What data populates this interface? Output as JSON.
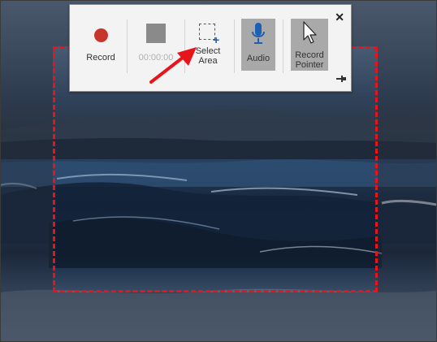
{
  "toolbar": {
    "record_label": "Record",
    "timer": "00:00:00",
    "select_area_line1": "Select",
    "select_area_line2": "Area",
    "audio_label": "Audio",
    "record_pointer_line1": "Record",
    "record_pointer_line2": "Pointer",
    "close_symbol": "✕",
    "audio_active": true,
    "record_pointer_active": true
  },
  "colors": {
    "selection_border": "#e8141b",
    "record_dot": "#c8352b",
    "annotation_arrow": "#e8141b",
    "active_button": "#a9a9a9",
    "toolbar_bg": "#f3f3f3"
  },
  "icons": {
    "record": "record-dot-icon",
    "stop": "stop-square-icon",
    "select_area": "dashed-box-plus-icon",
    "audio": "microphone-icon",
    "record_pointer": "mouse-pointer-icon",
    "close": "close-icon",
    "pin": "pin-icon"
  }
}
